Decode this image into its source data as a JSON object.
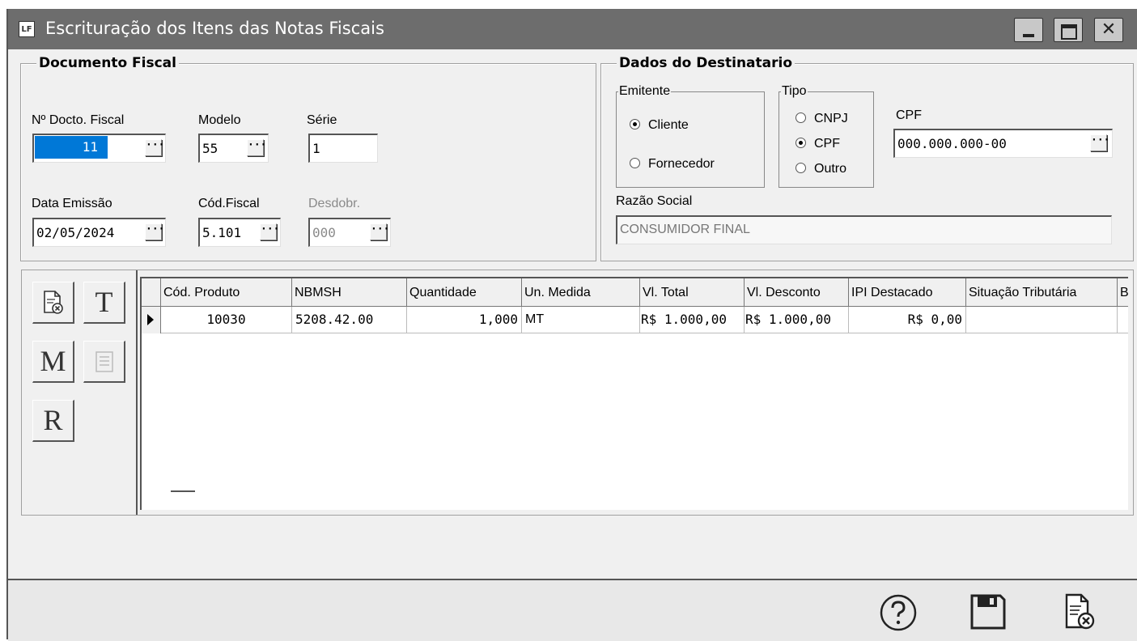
{
  "window": {
    "logo": "LF",
    "title": "Escrituração dos Itens das Notas Fiscais"
  },
  "documento": {
    "group_title": "Documento Fiscal",
    "n_docto_label": "Nº Docto. Fiscal",
    "n_docto_value": "11",
    "modelo_label": "Modelo",
    "modelo_value": "55",
    "serie_label": "Série",
    "serie_value": "1",
    "data_emissao_label": "Data Emissão",
    "data_emissao_value": "02/05/2024",
    "cod_fiscal_label": "Cód.Fiscal",
    "cod_fiscal_value": "5.101",
    "desdobr_label": "Desdobr.",
    "desdobr_value": "000"
  },
  "destinatario": {
    "group_title": "Dados do Destinatario",
    "emitente_title": "Emitente",
    "emitente_options": [
      "Cliente",
      "Fornecedor"
    ],
    "emitente_selected": "Cliente",
    "tipo_title": "Tipo",
    "tipo_options": [
      "CNPJ",
      "CPF",
      "Outro"
    ],
    "tipo_selected": "CPF",
    "cpf_label": "CPF",
    "cpf_value": "000.000.000-00",
    "razao_label": "Razão Social",
    "razao_value": "CONSUMIDOR FINAL"
  },
  "toolbox": {
    "t_label": "T",
    "m_label": "M",
    "r_label": "R"
  },
  "grid": {
    "columns": [
      "Cód. Produto",
      "NBMSH",
      "Quantidade",
      "Un. Medida",
      "Vl. Total",
      "Vl. Desconto",
      "IPI Destacado",
      "Situação Tributária",
      "B"
    ],
    "rows": [
      [
        "10030",
        "5208.42.00",
        "1,000",
        "MT",
        "R$ 1.000,00",
        "R$ 1.000,00",
        "R$ 0,00",
        "",
        ""
      ]
    ]
  },
  "footer": {
    "help_icon": "help-icon",
    "save_icon": "save-icon",
    "cancel_icon": "cancel-document-icon"
  }
}
